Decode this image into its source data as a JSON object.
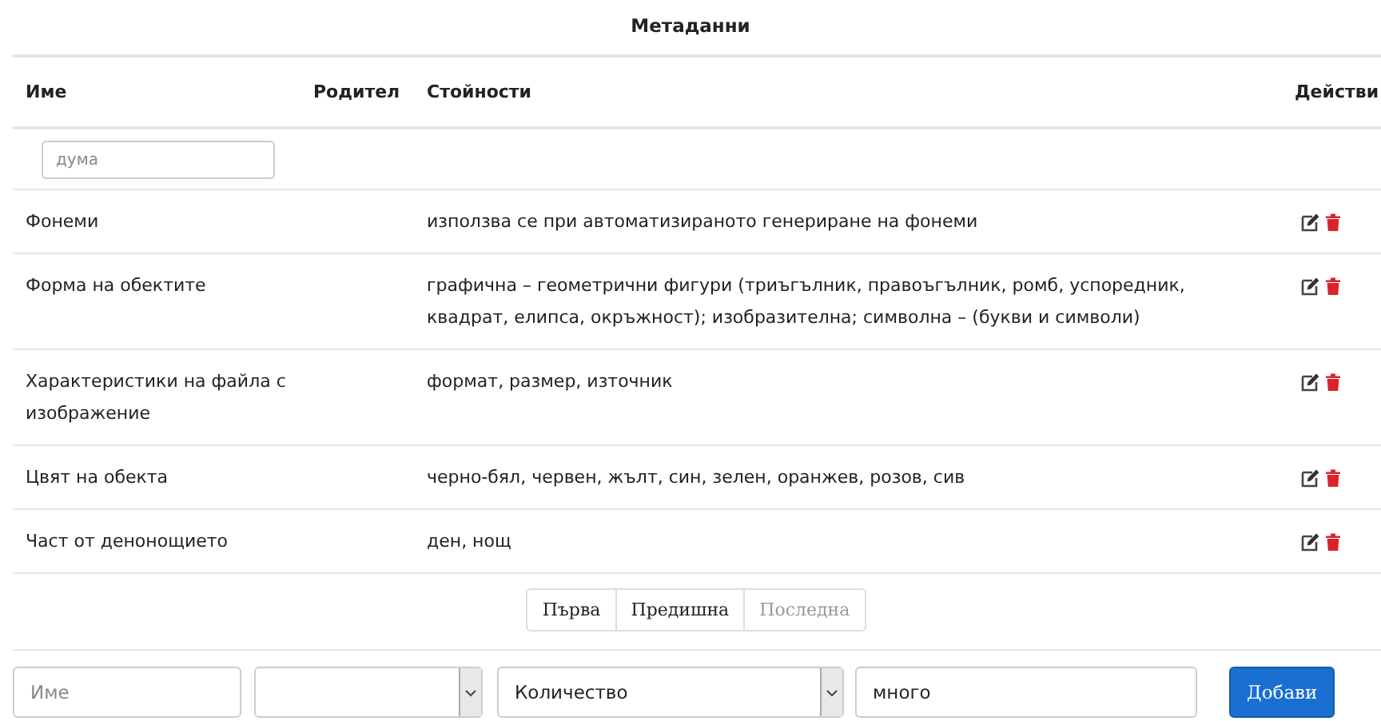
{
  "title": "Метаданни",
  "columns": [
    "Име",
    "Родител",
    "Стойности",
    "Действи"
  ],
  "filter": {
    "placeholder": "дума"
  },
  "rows": [
    {
      "name": "Фонеми",
      "values": "използва се при автоматизираното генериране на фонеми"
    },
    {
      "name": "Форма на обектите",
      "values": "графична – геометрични фигури (триъгълник, правоъгълник, ромб, успоредник, квадрат, елипса, окръжност); изобразителна; символна – (букви и символи)"
    },
    {
      "name": "Характеристики на файла с изображение",
      "values": "формат, размер, източник"
    },
    {
      "name": "Цвят на обекта",
      "values": "черно-бял, червен, жълт, син, зелен, оранжев, розов, сив"
    },
    {
      "name": "Част от денонощието",
      "values": "ден, нощ"
    }
  ],
  "pagination": [
    {
      "label": "Първа",
      "disabled": false
    },
    {
      "label": "Предишна",
      "disabled": false
    },
    {
      "label": "Последна",
      "disabled": true
    }
  ],
  "form": {
    "name_placeholder": "Име",
    "type_select": "Количество",
    "value": "много",
    "button": "Добави"
  }
}
